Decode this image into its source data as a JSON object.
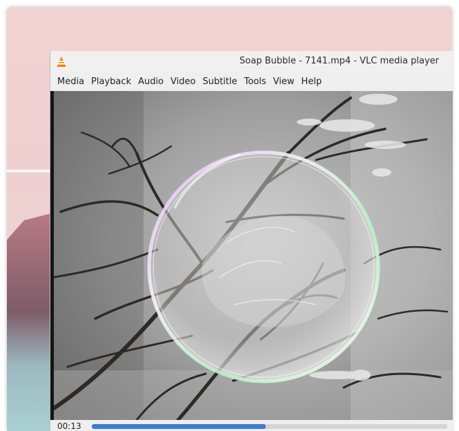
{
  "background_window": {
    "colors": {
      "wallpaper_top": "#f1d2d2",
      "mountain": "#7e5c68",
      "water": "#a9cfd2"
    }
  },
  "vlc": {
    "title": "Soap Bubble - 7141.mp4 - VLC media player",
    "app_icon": "vlc-cone-icon",
    "menu": [
      "Media",
      "Playback",
      "Audio",
      "Video",
      "Subtitle",
      "Tools",
      "View",
      "Help"
    ],
    "video": {
      "content": "soap-bubble-on-frosted-branches"
    },
    "controls": {
      "elapsed": "00:13",
      "progress": 0.49,
      "seek_color": "#3f7bd6"
    }
  }
}
